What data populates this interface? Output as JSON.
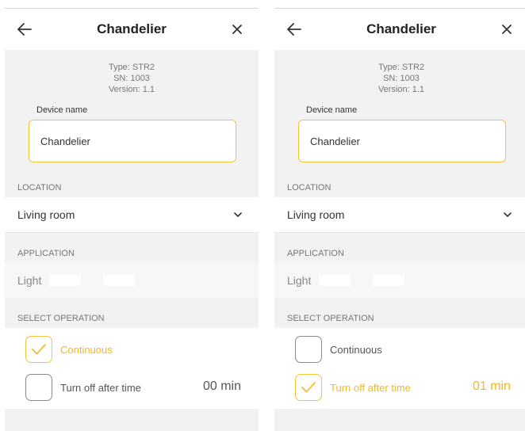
{
  "colors": {
    "accent": "#f5c23b",
    "section_bg": "#f2f2f2",
    "text": "#333333",
    "muted": "#777777"
  },
  "screens": [
    {
      "header": {
        "title": "Chandelier",
        "back_icon": "arrow-left-icon",
        "close_icon": "close-icon"
      },
      "info": {
        "type": "Type: STR2",
        "sn": "SN: 1003",
        "version": "Version: 1.1"
      },
      "device_name": {
        "label": "Device name",
        "value": "Chandelier"
      },
      "location": {
        "label": "LOCATION",
        "value": "Living room",
        "icon": "chevron-down-icon"
      },
      "application": {
        "label": "APPLICATION",
        "value": "Light"
      },
      "operation": {
        "label": "SELECT OPERATION",
        "options": [
          {
            "label": "Continuous",
            "checked": true
          },
          {
            "label": "Turn off after time",
            "checked": false,
            "time": "00 min"
          }
        ]
      }
    },
    {
      "header": {
        "title": "Chandelier",
        "back_icon": "arrow-left-icon",
        "close_icon": "close-icon"
      },
      "info": {
        "type": "Type: STR2",
        "sn": "SN: 1003",
        "version": "Version: 1.1"
      },
      "device_name": {
        "label": "Device name",
        "value": "Chandelier"
      },
      "location": {
        "label": "LOCATION",
        "value": "Living room",
        "icon": "chevron-down-icon"
      },
      "application": {
        "label": "APPLICATION",
        "value": "Light"
      },
      "operation": {
        "label": "SELECT OPERATION",
        "options": [
          {
            "label": "Continuous",
            "checked": false
          },
          {
            "label": "Turn off after time",
            "checked": true,
            "time": "01 min"
          }
        ]
      }
    }
  ]
}
